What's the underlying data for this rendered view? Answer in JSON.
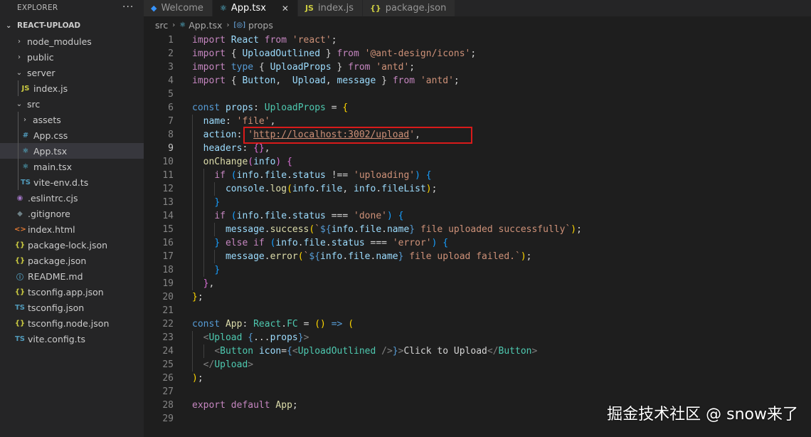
{
  "sidebar": {
    "title": "EXPLORER",
    "more": "···",
    "project": "REACT-UPLOAD",
    "items": [
      {
        "label": "node_modules",
        "icon": "folder",
        "depth": 1,
        "twisty": "›"
      },
      {
        "label": "public",
        "icon": "folder",
        "depth": 1,
        "twisty": "›"
      },
      {
        "label": "server",
        "icon": "folder-open",
        "depth": 1,
        "twisty": "⌄"
      },
      {
        "label": "index.js",
        "icon": "JS",
        "depth": 2,
        "twisty": ""
      },
      {
        "label": "src",
        "icon": "folder-open",
        "depth": 1,
        "twisty": "⌄"
      },
      {
        "label": "assets",
        "icon": "folder",
        "depth": 2,
        "twisty": "›"
      },
      {
        "label": "App.css",
        "icon": "#",
        "depth": 2,
        "twisty": ""
      },
      {
        "label": "App.tsx",
        "icon": "⚛",
        "depth": 2,
        "twisty": "",
        "selected": true
      },
      {
        "label": "main.tsx",
        "icon": "⚛",
        "depth": 2,
        "twisty": ""
      },
      {
        "label": "vite-env.d.ts",
        "icon": "TS",
        "depth": 2,
        "twisty": ""
      },
      {
        "label": ".eslintrc.cjs",
        "icon": "◉",
        "depth": 1,
        "twisty": ""
      },
      {
        "label": ".gitignore",
        "icon": "◆",
        "depth": 1,
        "twisty": ""
      },
      {
        "label": "index.html",
        "icon": "<>",
        "depth": 1,
        "twisty": ""
      },
      {
        "label": "package-lock.json",
        "icon": "{}",
        "depth": 1,
        "twisty": ""
      },
      {
        "label": "package.json",
        "icon": "{}",
        "depth": 1,
        "twisty": ""
      },
      {
        "label": "README.md",
        "icon": "ⓘ",
        "depth": 1,
        "twisty": ""
      },
      {
        "label": "tsconfig.app.json",
        "icon": "{}",
        "depth": 1,
        "twisty": ""
      },
      {
        "label": "tsconfig.json",
        "icon": "TS",
        "depth": 1,
        "twisty": ""
      },
      {
        "label": "tsconfig.node.json",
        "icon": "{}",
        "depth": 1,
        "twisty": ""
      },
      {
        "label": "vite.config.ts",
        "icon": "TS",
        "depth": 1,
        "twisty": ""
      }
    ]
  },
  "tabs": [
    {
      "label": "Welcome",
      "icon": "vscode-icon",
      "active": false
    },
    {
      "label": "App.tsx",
      "icon": "react-icon",
      "active": true,
      "close": "✕"
    },
    {
      "label": "index.js",
      "icon": "JS",
      "active": false
    },
    {
      "label": "package.json",
      "icon": "{}",
      "active": false
    }
  ],
  "breadcrumb": {
    "parts": [
      "src",
      "App.tsx",
      "props"
    ]
  },
  "editor": {
    "current_line": 9,
    "lines": [
      [
        [
          "kc",
          "import "
        ],
        [
          "id",
          "React "
        ],
        [
          "kc",
          "from "
        ],
        [
          "st",
          "'react'"
        ],
        [
          "pu",
          ";"
        ]
      ],
      [
        [
          "kc",
          "import "
        ],
        [
          "pu",
          "{ "
        ],
        [
          "id",
          "UploadOutlined "
        ],
        [
          "pu",
          "} "
        ],
        [
          "kc",
          "from "
        ],
        [
          "st",
          "'@ant-design/icons'"
        ],
        [
          "pu",
          ";"
        ]
      ],
      [
        [
          "kc",
          "import "
        ],
        [
          "kw",
          "type "
        ],
        [
          "pu",
          "{ "
        ],
        [
          "id",
          "UploadProps "
        ],
        [
          "pu",
          "} "
        ],
        [
          "kc",
          "from "
        ],
        [
          "st",
          "'antd'"
        ],
        [
          "pu",
          ";"
        ]
      ],
      [
        [
          "kc",
          "import "
        ],
        [
          "pu",
          "{ "
        ],
        [
          "id",
          "Button"
        ],
        [
          "pu",
          ",  "
        ],
        [
          "id",
          "Upload"
        ],
        [
          "pu",
          ", "
        ],
        [
          "id",
          "message "
        ],
        [
          "pu",
          "} "
        ],
        [
          "kc",
          "from "
        ],
        [
          "st",
          "'antd'"
        ],
        [
          "pu",
          ";"
        ]
      ],
      [],
      [
        [
          "kw",
          "const "
        ],
        [
          "id",
          "props"
        ],
        [
          "pu",
          ": "
        ],
        [
          "ty",
          "UploadProps "
        ],
        [
          "pu",
          "= "
        ],
        [
          "br1",
          "{"
        ]
      ],
      [
        [
          "pu",
          "  "
        ],
        [
          "id",
          "name"
        ],
        [
          "pu",
          ": "
        ],
        [
          "st",
          "'file'"
        ],
        [
          "pu",
          ","
        ]
      ],
      [
        [
          "pu",
          "  "
        ],
        [
          "id",
          "action"
        ],
        [
          "pu",
          ": "
        ],
        [
          "st",
          "'"
        ],
        [
          "st ul",
          "http://localhost:3002/upload"
        ],
        [
          "st",
          "'"
        ],
        [
          "pu",
          ","
        ]
      ],
      [
        [
          "pu",
          "  "
        ],
        [
          "id",
          "headers"
        ],
        [
          "pu",
          ": "
        ],
        [
          "br2",
          "{}"
        ],
        [
          "pu",
          ","
        ]
      ],
      [
        [
          "pu",
          "  "
        ],
        [
          "fn",
          "onChange"
        ],
        [
          "br2",
          "("
        ],
        [
          "id",
          "info"
        ],
        [
          "br2",
          ") "
        ],
        [
          "br2",
          "{"
        ]
      ],
      [
        [
          "pu",
          "    "
        ],
        [
          "kc",
          "if "
        ],
        [
          "br3",
          "("
        ],
        [
          "id",
          "info"
        ],
        [
          "pu",
          "."
        ],
        [
          "id",
          "file"
        ],
        [
          "pu",
          "."
        ],
        [
          "id",
          "status "
        ],
        [
          "pu",
          "!== "
        ],
        [
          "st",
          "'uploading'"
        ],
        [
          "br3",
          ") "
        ],
        [
          "br3",
          "{"
        ]
      ],
      [
        [
          "pu",
          "      "
        ],
        [
          "id",
          "console"
        ],
        [
          "pu",
          "."
        ],
        [
          "fn",
          "log"
        ],
        [
          "br1",
          "("
        ],
        [
          "id",
          "info"
        ],
        [
          "pu",
          "."
        ],
        [
          "id",
          "file"
        ],
        [
          "pu",
          ", "
        ],
        [
          "id",
          "info"
        ],
        [
          "pu",
          "."
        ],
        [
          "id",
          "fileList"
        ],
        [
          "br1",
          ")"
        ],
        [
          "pu",
          ";"
        ]
      ],
      [
        [
          "pu",
          "    "
        ],
        [
          "br3",
          "}"
        ]
      ],
      [
        [
          "pu",
          "    "
        ],
        [
          "kc",
          "if "
        ],
        [
          "br3",
          "("
        ],
        [
          "id",
          "info"
        ],
        [
          "pu",
          "."
        ],
        [
          "id",
          "file"
        ],
        [
          "pu",
          "."
        ],
        [
          "id",
          "status "
        ],
        [
          "pu",
          "=== "
        ],
        [
          "st",
          "'done'"
        ],
        [
          "br3",
          ") "
        ],
        [
          "br3",
          "{"
        ]
      ],
      [
        [
          "pu",
          "      "
        ],
        [
          "id",
          "message"
        ],
        [
          "pu",
          "."
        ],
        [
          "fn",
          "success"
        ],
        [
          "br1",
          "("
        ],
        [
          "st",
          "`"
        ],
        [
          "kw",
          "${"
        ],
        [
          "id",
          "info"
        ],
        [
          "pu",
          "."
        ],
        [
          "id",
          "file"
        ],
        [
          "pu",
          "."
        ],
        [
          "id",
          "name"
        ],
        [
          "kw",
          "}"
        ],
        [
          "st",
          " file uploaded successfully`"
        ],
        [
          "br1",
          ")"
        ],
        [
          "pu",
          ";"
        ]
      ],
      [
        [
          "pu",
          "    "
        ],
        [
          "br3",
          "} "
        ],
        [
          "kc",
          "else if "
        ],
        [
          "br3",
          "("
        ],
        [
          "id",
          "info"
        ],
        [
          "pu",
          "."
        ],
        [
          "id",
          "file"
        ],
        [
          "pu",
          "."
        ],
        [
          "id",
          "status "
        ],
        [
          "pu",
          "=== "
        ],
        [
          "st",
          "'error'"
        ],
        [
          "br3",
          ") "
        ],
        [
          "br3",
          "{"
        ]
      ],
      [
        [
          "pu",
          "      "
        ],
        [
          "id",
          "message"
        ],
        [
          "pu",
          "."
        ],
        [
          "fn",
          "error"
        ],
        [
          "br1",
          "("
        ],
        [
          "st",
          "`"
        ],
        [
          "kw",
          "${"
        ],
        [
          "id",
          "info"
        ],
        [
          "pu",
          "."
        ],
        [
          "id",
          "file"
        ],
        [
          "pu",
          "."
        ],
        [
          "id",
          "name"
        ],
        [
          "kw",
          "}"
        ],
        [
          "st",
          " file upload failed.`"
        ],
        [
          "br1",
          ")"
        ],
        [
          "pu",
          ";"
        ]
      ],
      [
        [
          "pu",
          "    "
        ],
        [
          "br3",
          "}"
        ]
      ],
      [
        [
          "pu",
          "  "
        ],
        [
          "br2",
          "}"
        ],
        [
          "pu",
          ","
        ]
      ],
      [
        [
          "br1",
          "}"
        ],
        [
          "pu",
          ";"
        ]
      ],
      [],
      [
        [
          "kw",
          "const "
        ],
        [
          "fn",
          "App"
        ],
        [
          "pu",
          ": "
        ],
        [
          "ty",
          "React"
        ],
        [
          "pu",
          "."
        ],
        [
          "ty",
          "FC "
        ],
        [
          "pu",
          "= "
        ],
        [
          "br1",
          "() "
        ],
        [
          "kw",
          "=> "
        ],
        [
          "br1",
          "("
        ]
      ],
      [
        [
          "pu",
          "  "
        ],
        [
          "tg",
          "<"
        ],
        [
          "cmp",
          "Upload "
        ],
        [
          "kw",
          "{"
        ],
        [
          "pu",
          "..."
        ],
        [
          "id",
          "props"
        ],
        [
          "kw",
          "}"
        ],
        [
          "tg",
          ">"
        ]
      ],
      [
        [
          "pu",
          "    "
        ],
        [
          "tg",
          "<"
        ],
        [
          "cmp",
          "Button "
        ],
        [
          "id",
          "icon"
        ],
        [
          "pu",
          "="
        ],
        [
          "kw",
          "{"
        ],
        [
          "tg",
          "<"
        ],
        [
          "cmp",
          "UploadOutlined "
        ],
        [
          "tg",
          "/>"
        ],
        [
          "kw",
          "}"
        ],
        [
          "tg",
          ">"
        ],
        [
          "pu",
          "Click to Upload"
        ],
        [
          "tg",
          "</"
        ],
        [
          "cmp",
          "Button"
        ],
        [
          "tg",
          ">"
        ]
      ],
      [
        [
          "pu",
          "  "
        ],
        [
          "tg",
          "</"
        ],
        [
          "cmp",
          "Upload"
        ],
        [
          "tg",
          ">"
        ]
      ],
      [
        [
          "br1",
          ")"
        ],
        [
          "pu",
          ";"
        ]
      ],
      [],
      [
        [
          "kc",
          "export "
        ],
        [
          "kc",
          "default "
        ],
        [
          "fn",
          "App"
        ],
        [
          "pu",
          ";"
        ]
      ],
      []
    ]
  },
  "watermark": "掘金技术社区 @ snow来了"
}
